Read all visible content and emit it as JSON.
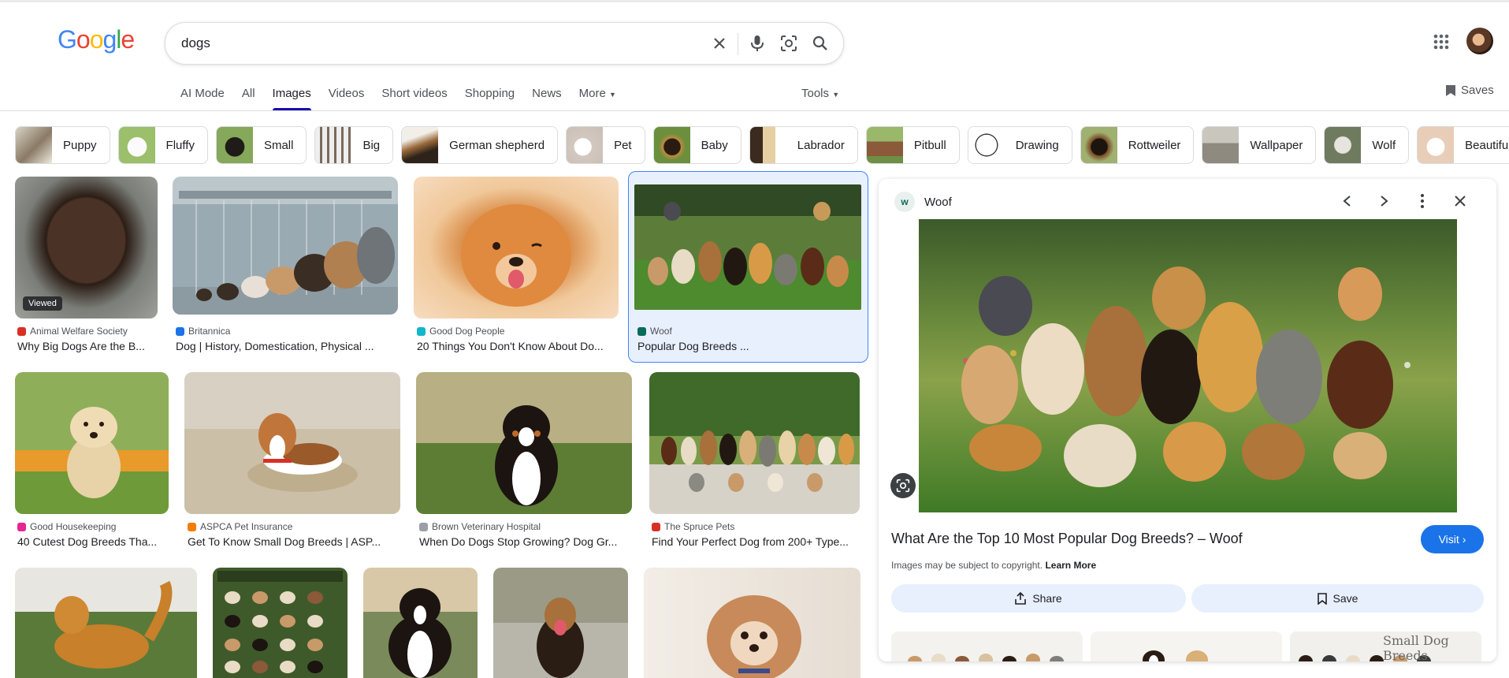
{
  "header": {
    "logo": "Google",
    "search_query": "dogs",
    "saves_label": "Saves"
  },
  "nav": {
    "tabs": [
      "AI Mode",
      "All",
      "Images",
      "Videos",
      "Short videos",
      "Shopping",
      "News",
      "More"
    ],
    "active": "Images",
    "tools_label": "Tools"
  },
  "chips": [
    "Puppy",
    "Fluffy",
    "Small",
    "Big",
    "German shepherd",
    "Pet",
    "Baby",
    "Labrador",
    "Pitbull",
    "Drawing",
    "Rottweiler",
    "Wallpaper",
    "Wolf",
    "Beautiful"
  ],
  "results": [
    {
      "source": "Animal Welfare Society",
      "title": "Why Big Dogs Are the B...",
      "badge": "Viewed",
      "src_color": "#d93025"
    },
    {
      "source": "Britannica",
      "title": "Dog | History, Domestication, Physical ...",
      "src_color": "#1a73e8"
    },
    {
      "source": "Good Dog People",
      "title": "20 Things You Don't Know About Do...",
      "src_color": "#12b5cb"
    },
    {
      "source": "Woof",
      "title": "Popular Dog Breeds ...",
      "src_color": "#0b6b5b"
    },
    {
      "source": "Good Housekeeping",
      "title": "40 Cutest Dog Breeds Tha...",
      "src_color": "#e52592"
    },
    {
      "source": "ASPCA Pet Insurance",
      "title": "Get To Know Small Dog Breeds | ASP...",
      "src_color": "#f57c00"
    },
    {
      "source": "Brown Veterinary Hospital",
      "title": "When Do Dogs Stop Growing? Dog Gr...",
      "src_color": "#9aa0a6"
    },
    {
      "source": "The Spruce Pets",
      "title": "Find Your Perfect Dog from 200+ Type...",
      "src_color": "#d93025"
    }
  ],
  "panel": {
    "site": "Woof",
    "title": "What Are the Top 10 Most Popular Dog Breeds? – Woof",
    "visit_label": "Visit",
    "copyright_text": "Images may be subject to copyright.",
    "learn_more": "Learn More",
    "share_label": "Share",
    "save_label": "Save",
    "related_caption": "Small Dog Breeds"
  }
}
